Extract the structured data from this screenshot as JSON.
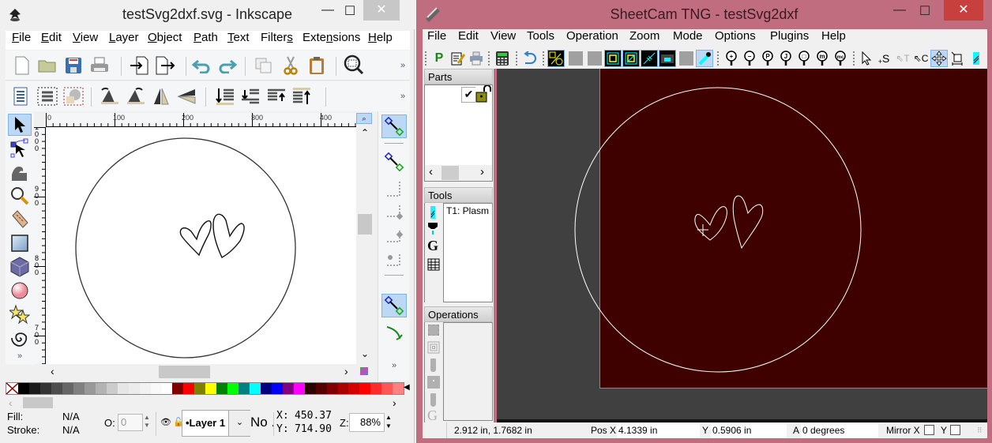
{
  "inkscape": {
    "title": "testSvg2dxf.svg - Inkscape",
    "window_controls": {
      "minimize": "—",
      "maximize": "☐",
      "close": "✕"
    },
    "menu": [
      {
        "label": "File",
        "key": "F"
      },
      {
        "label": "Edit",
        "key": "E"
      },
      {
        "label": "View",
        "key": "V"
      },
      {
        "label": "Layer",
        "key": "L"
      },
      {
        "label": "Object",
        "key": "O"
      },
      {
        "label": "Path",
        "key": "P"
      },
      {
        "label": "Text",
        "key": "T"
      },
      {
        "label": "Filters",
        "key": "s"
      },
      {
        "label": "Extensions",
        "key": "n"
      },
      {
        "label": "Help",
        "key": "H"
      }
    ],
    "toolbar_commands": [
      "new-document-icon",
      "open-folder-icon",
      "save-icon",
      "print-icon",
      "import-icon",
      "export-icon",
      "undo-icon",
      "redo-icon",
      "duplicate-icon",
      "cut-icon",
      "paste-icon",
      "zoom-fit-icon"
    ],
    "toolbar_align": [
      "document-properties-icon",
      "layers-icon",
      "fill-stroke-icon",
      "rotate-ccw-icon",
      "rotate-cw-icon",
      "flip-horizontal-icon",
      "flip-vertical-icon",
      "lower-to-bottom-icon",
      "lower-icon",
      "raise-icon",
      "raise-to-top-icon"
    ],
    "overflow_glyph": "»",
    "tools": [
      "selector",
      "node",
      "tweak",
      "zoom",
      "measure",
      "rectangle",
      "3d-box",
      "ellipse",
      "star",
      "spiral"
    ],
    "ruler": {
      "h_labels": [
        "0",
        "100",
        "200",
        "300",
        "400"
      ],
      "v_labels": [
        "1000",
        "900",
        "800",
        "700"
      ]
    },
    "palette": [
      "#000000",
      "#1a1a1a",
      "#333333",
      "#4d4d4d",
      "#666666",
      "#808080",
      "#999999",
      "#b3b3b3",
      "#cccccc",
      "#e6e6e6",
      "#ececec",
      "#f2f2f2",
      "#f9f9f9",
      "#ffffff",
      "#800000",
      "#ff0000",
      "#808000",
      "#ffff00",
      "#008000",
      "#00ff00",
      "#008080",
      "#00ffff",
      "#000080",
      "#0000ff",
      "#800080",
      "#ff00ff",
      "#2b0000",
      "#550000",
      "#800000",
      "#aa0000",
      "#d40000",
      "#ff0000",
      "#ff2a2a",
      "#ff5555",
      "#ff8080"
    ],
    "status": {
      "fill_label": "Fill:",
      "fill_value": "N/A",
      "stroke_label": "Stroke:",
      "stroke_value": "N/A",
      "opacity_label": "O:",
      "opacity_value": "0",
      "layer": "•Layer 1",
      "message": "No .",
      "x_label": "X:",
      "x_value": "450.37",
      "y_label": "Y:",
      "y_value": "714.90",
      "zoom_label": "Z:",
      "zoom_value": "88%"
    }
  },
  "sheetcam": {
    "title": "SheetCam TNG - testSvg2dxf",
    "window_controls": {
      "minimize": "—",
      "maximize": "☐",
      "close": "✕"
    },
    "menu": [
      "File",
      "Edit",
      "View",
      "Tools",
      "Operation",
      "Zoom",
      "Mode",
      "Options",
      "Plugins",
      "Help"
    ],
    "toolbar": {
      "post_label": "P",
      "plugin_glyphs": [
        "+",
        "−",
        "P",
        "J",
        "□",
        "m",
        "mc"
      ],
      "mode_glyphs": [
        "S",
        "T",
        "C"
      ]
    },
    "panels": {
      "parts_title": "Parts",
      "tools_title": "Tools",
      "tool_item": "T1: Plasm",
      "operations_title": "Operations"
    },
    "status": {
      "cursor": "2.912 in, 1.7682 in",
      "posx_label": "Pos X",
      "posx_value": "4.1339 in",
      "y_label": "Y",
      "y_value": "0.5906 in",
      "a_label": "A",
      "a_value": "0 degrees",
      "mirror_label": "Mirror X",
      "mirror_y_label": "Y"
    },
    "colors": {
      "sheet": "#3f0000",
      "background": "#404040",
      "frame": "#c16d80"
    }
  }
}
